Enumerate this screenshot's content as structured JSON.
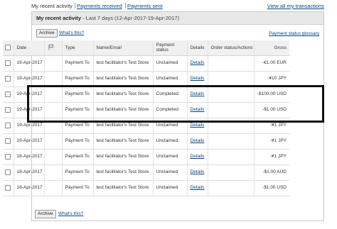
{
  "nav": {
    "tabs": [
      "My recent activity",
      "Payments received",
      "Payments sent"
    ],
    "view_all": "View all my transactions"
  },
  "panel": {
    "title": "My recent activity",
    "range": " - Last 7 days (12-Apr-2017-19-Apr-2017)"
  },
  "toolbar": {
    "archive_label": "Archive",
    "whats_this": "What's this?",
    "glossary": "Payment status glossary"
  },
  "table": {
    "headers": [
      "Date",
      "",
      "Type",
      "Name/Email",
      "Payment status",
      "Details",
      "Order status/Actions",
      "Gross"
    ],
    "rows": [
      {
        "date": "19-Apr-2017",
        "type": "Payment To",
        "name": "test facilitator's Test Store",
        "status": "Unclaimed",
        "details": "Details",
        "gross": "-€1.00 EUR"
      },
      {
        "date": "19-Apr-2017",
        "type": "Payment To",
        "name": "test facilitator's Test Store",
        "status": "Unclaimed",
        "details": "Details",
        "gross": "-¥10 JPY"
      },
      {
        "date": "19-Apr-2017",
        "type": "Payment To",
        "name": "test facilitator's Test Store",
        "status": "Completed",
        "details": "Details",
        "gross": "-$100.00 USD"
      },
      {
        "date": "19-Apr-2017",
        "type": "Payment To",
        "name": "test facilitator's Test Store",
        "status": "Completed",
        "details": "Details",
        "gross": "-$1.00 USD"
      },
      {
        "date": "19-Apr-2017",
        "type": "Payment To",
        "name": "test facilitator's Test Store",
        "status": "Unclaimed",
        "details": "Details",
        "gross": "-¥1 JPY"
      },
      {
        "date": "19-Apr-2017",
        "type": "Payment To",
        "name": "test facilitator's Test Store",
        "status": "Unclaimed",
        "details": "Details",
        "gross": "-¥1 JPY"
      },
      {
        "date": "18-Apr-2017",
        "type": "Payment To",
        "name": "test facilitator's Test Store",
        "status": "Unclaimed",
        "details": "Details",
        "gross": "-¥1 JPY"
      },
      {
        "date": "18-Apr-2017",
        "type": "Payment To",
        "name": "test facilitator's Test Store",
        "status": "Unclaimed",
        "details": "Details",
        "gross": "-$1.00 AUD"
      },
      {
        "date": "18-Apr-2017",
        "type": "Payment To",
        "name": "test facilitator's Test Store",
        "status": "Unclaimed",
        "details": "Details",
        "gross": "-$1.00 USD"
      }
    ]
  },
  "colors": {
    "link": "#084482",
    "header_bg": "#e8e8e8",
    "highlight": "#111111"
  }
}
